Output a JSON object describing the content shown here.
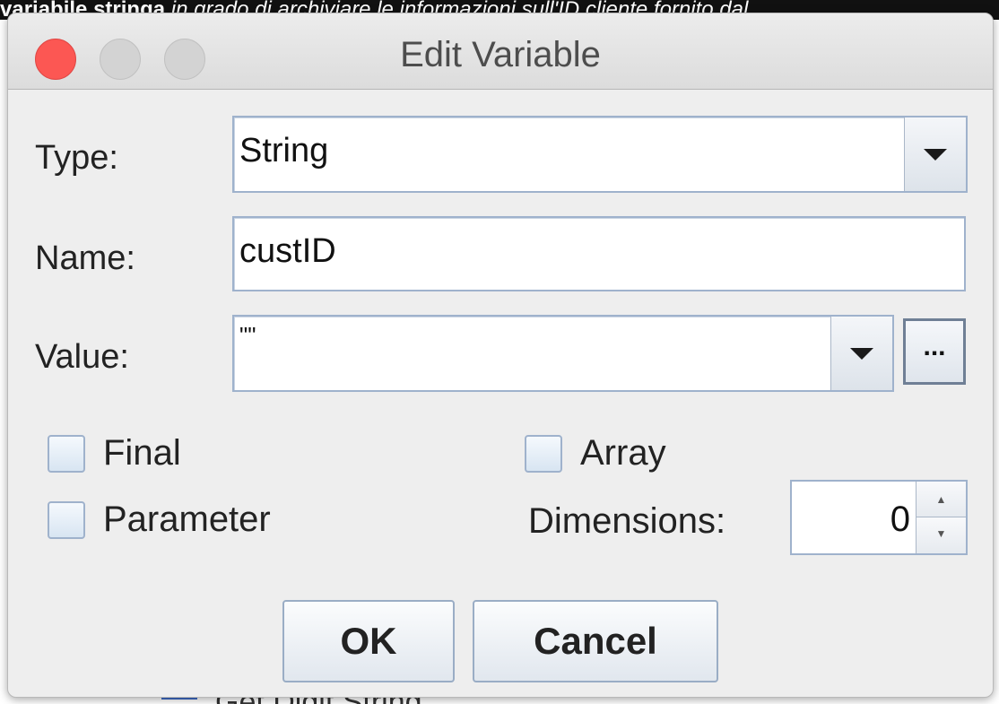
{
  "background": {
    "top_text_bold": "variabile stringa",
    "top_text_italic": " in grado di archiviare le informazioni sull'ID cliente fornito dal",
    "bottom_text": "Get Digit String"
  },
  "dialog": {
    "title": "Edit Variable",
    "type_label": "Type:",
    "type_value": "String",
    "name_label": "Name:",
    "name_value": "custID",
    "value_label": "Value:",
    "value_value": "\"\"",
    "ellipsis_label": "...",
    "final_label": "Final",
    "array_label": "Array",
    "parameter_label": "Parameter",
    "dimensions_label": "Dimensions:",
    "dimensions_value": "0",
    "ok_label": "OK",
    "cancel_label": "Cancel"
  },
  "icons": {
    "close": "close-icon",
    "minimize": "minimize-icon",
    "maximize": "maximize-icon",
    "dropdown": "chevron-down-icon"
  },
  "colors": {
    "close_button": "#fc5753",
    "field_border": "#9fb2cc",
    "dialog_bg": "#eeeeee"
  }
}
